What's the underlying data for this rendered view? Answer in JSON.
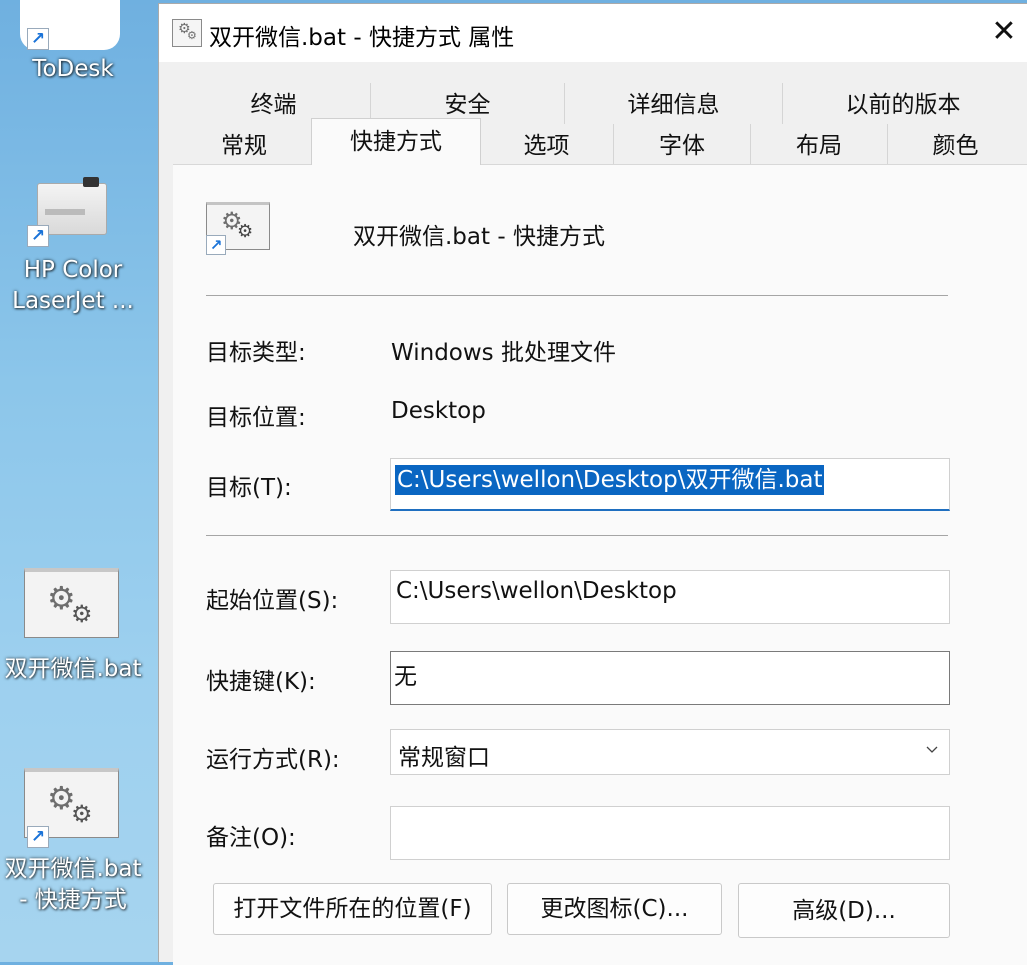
{
  "desktop": {
    "icons": [
      {
        "label": "ToDesk",
        "icon": "todesk-logo-icon"
      },
      {
        "label": "HP Color\nLaserJet ...",
        "icon": "printer-icon"
      },
      {
        "label": "双开微信.bat",
        "icon": "batch-file-icon"
      },
      {
        "label": "双开微信.bat\n- 快捷方式",
        "icon": "batch-file-shortcut-icon"
      }
    ]
  },
  "dialog": {
    "title": "双开微信.bat - 快捷方式 属性",
    "close_glyph": "✕",
    "tabs_row1": [
      "终端",
      "安全",
      "详细信息",
      "以前的版本"
    ],
    "tabs_row2": [
      "常规",
      "快捷方式",
      "选项",
      "字体",
      "布局",
      "颜色"
    ],
    "active_tab": "快捷方式",
    "heading": "双开微信.bat - 快捷方式",
    "target_type_label": "目标类型:",
    "target_type_value": "Windows 批处理文件",
    "target_location_label": "目标位置:",
    "target_location_value": "Desktop",
    "target_label": "目标(T):",
    "target_value": "C:\\Users\\wellon\\Desktop\\双开微信.bat",
    "start_in_label": "起始位置(S):",
    "start_in_value": "C:\\Users\\wellon\\Desktop",
    "hotkey_label": "快捷键(K):",
    "hotkey_value": "无",
    "run_label": "运行方式(R):",
    "run_value": "常规窗口",
    "comment_label": "备注(O):",
    "comment_value": "",
    "buttons": {
      "open_location": "打开文件所在的位置(F)",
      "change_icon": "更改图标(C)...",
      "advanced": "高级(D)..."
    }
  },
  "colors": {
    "selection": "#0a66c2",
    "dialog_bg": "#f0f0f0",
    "panel_bg": "#fafafa"
  }
}
